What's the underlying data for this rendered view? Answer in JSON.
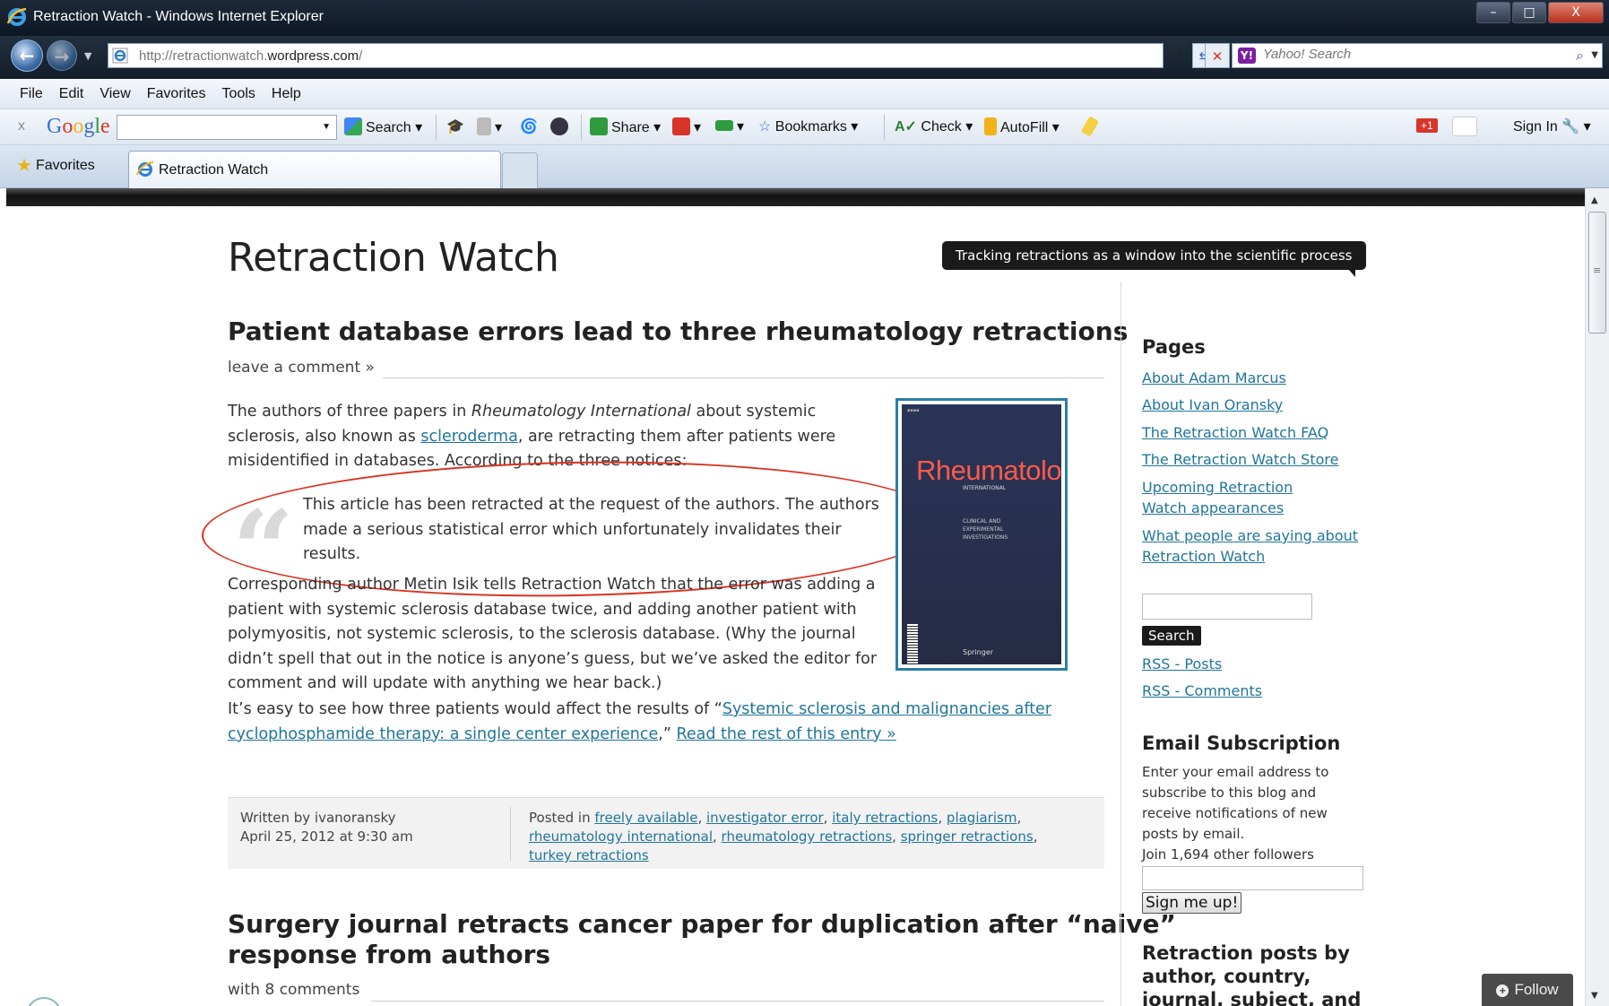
{
  "window": {
    "title": "Retraction Watch - Windows Internet Explorer",
    "controls": [
      "–",
      "□",
      "X"
    ]
  },
  "address_bar": {
    "url_prefix": "http://retractionwatch.",
    "url_domain": "wordpress.com",
    "url_suffix": "/",
    "search_placeholder": "Yahoo! Search",
    "search_provider_icon": "Y!"
  },
  "menu": [
    "File",
    "Edit",
    "View",
    "Favorites",
    "Tools",
    "Help"
  ],
  "google_toolbar": {
    "close": "x",
    "logo": "Google",
    "search_label": "Search",
    "share_label": "Share",
    "bookmarks_label": "Bookmarks",
    "check_label": "Check",
    "autofill_label": "AutoFill",
    "gplus_label": "+1",
    "signin_label": "Sign In"
  },
  "tabs": {
    "favorites_label": "Favorites",
    "active_tab": "Retraction Watch"
  },
  "site": {
    "title": "Retraction Watch",
    "tagline": "Tracking retractions as a window into the scientific process"
  },
  "post1": {
    "title": "Patient database errors lead to three rheumatology retractions",
    "comments": "leave a comment »",
    "p1_a": "The authors of three papers in ",
    "p1_journal": "Rheumatology International",
    "p1_b": " about systemic",
    "p1_c": "sclerosis, also known as ",
    "p1_link": "scleroderma",
    "p1_d": ", are retracting them after patients were",
    "p1_e": "misidentified in databases. According to the three notices:",
    "quote": "This article has been retracted at the request of the authors. The authors made a serious statistical error which unfortunately invalidates their results.",
    "p2": "Corresponding author Metin Isik tells Retraction Watch that the error was adding a patient with systemic sclerosis database twice, and adding another patient with polymyositis, not systemic sclerosis, to the sclerosis database. (Why the journal didn’t spell that out in the notice is anyone’s guess, but we’ve asked the editor for comment and will update with anything we hear back.)",
    "p3_a": "It’s easy to see how three patients would affect the results of “",
    "p3_link1": "Systemic sclerosis and malignancies after",
    "p3_link2": "cyclophosphamide therapy: a single center experience",
    "p3_b": ",” ",
    "p3_more": "Read the rest of this entry »",
    "cover": {
      "title": "Rheumatology",
      "subtitle": "INTERNATIONAL",
      "lines": "CLINICAL AND\nEXPERIMENTAL\nINVESTIGATIONS",
      "publisher": "Springer"
    },
    "footer": {
      "written_by": "Written by ivanoransky",
      "date": "April 25, 2012 at 9:30 am",
      "posted_in": "Posted in",
      "tags": [
        "freely available",
        "investigator error",
        "italy retractions",
        "plagiarism",
        "rheumatology international",
        "rheumatology retractions",
        "springer retractions",
        "turkey retractions"
      ]
    }
  },
  "post2": {
    "title_line1": "Surgery journal retracts cancer paper for duplication after “naive”",
    "title_line2": "response from authors",
    "comments": "with 8 comments"
  },
  "sidebar": {
    "pages_heading": "Pages",
    "pages": [
      "About Adam Marcus",
      "About Ivan Oransky",
      "The Retraction Watch FAQ",
      "The Retraction Watch Store",
      "Upcoming Retraction",
      "Watch appearances",
      "What people are saying about",
      "Retraction Watch"
    ],
    "search_button": "Search",
    "rss_posts": "RSS - Posts",
    "rss_comments": "RSS - Comments",
    "email_heading": "Email Subscription",
    "email_text": [
      "Enter your email address to",
      "subscribe to this blog and",
      "receive notifications of new",
      "posts by email."
    ],
    "followers": "Join 1,694 other followers",
    "signup_button": "Sign me up!",
    "retraction_heading": [
      "Retraction posts by",
      "author, country,",
      "journal, subject, and"
    ]
  },
  "follow_button": "Follow"
}
